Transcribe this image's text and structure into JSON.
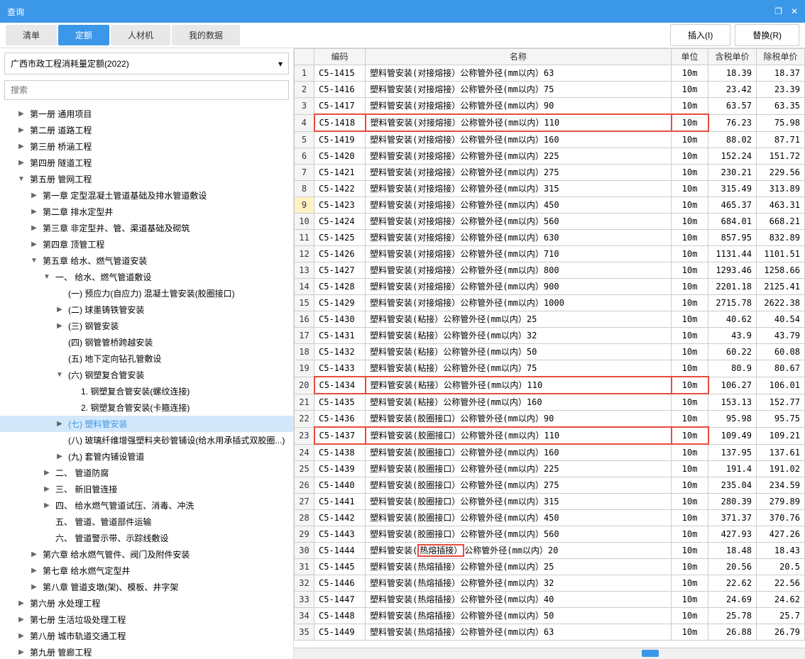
{
  "title": "查询",
  "tabs": [
    "清单",
    "定额",
    "人材机",
    "我的数据"
  ],
  "active_tab": 1,
  "btn_insert": "插入(I)",
  "btn_replace": "替换(R)",
  "dropdown": "广西市政工程消耗量定额(2022)",
  "search_placeholder": "搜索",
  "tree": [
    {
      "d": 1,
      "t": "▶",
      "l": "第一册 通用项目"
    },
    {
      "d": 1,
      "t": "▶",
      "l": "第二册 道路工程"
    },
    {
      "d": 1,
      "t": "▶",
      "l": "第三册 桥涵工程"
    },
    {
      "d": 1,
      "t": "▶",
      "l": "第四册 隧道工程"
    },
    {
      "d": 1,
      "t": "▼",
      "l": "第五册 管网工程"
    },
    {
      "d": 2,
      "t": "▶",
      "l": "第一章 定型混凝土管道基础及排水管道敷设"
    },
    {
      "d": 2,
      "t": "▶",
      "l": "第二章 排水定型井"
    },
    {
      "d": 2,
      "t": "▶",
      "l": "第三章 非定型井、管、渠道基础及砌筑"
    },
    {
      "d": 2,
      "t": "▶",
      "l": "第四章 顶管工程"
    },
    {
      "d": 2,
      "t": "▼",
      "l": "第五章 给水、燃气管道安装"
    },
    {
      "d": 3,
      "t": "▼",
      "l": "一、 给水、燃气管道敷设"
    },
    {
      "d": 4,
      "t": "",
      "l": "(一) 预应力(自应力) 混凝土管安装(胶圈接口)"
    },
    {
      "d": 4,
      "t": "▶",
      "l": "(二) 球墨铸铁管安装"
    },
    {
      "d": 4,
      "t": "▶",
      "l": "(三) 钢管安装"
    },
    {
      "d": 4,
      "t": "",
      "l": "(四) 钢管管桥跨越安装"
    },
    {
      "d": 4,
      "t": "",
      "l": "(五) 地下定向钻孔管敷设"
    },
    {
      "d": 4,
      "t": "▼",
      "l": "(六) 钢塑复合管安装"
    },
    {
      "d": 5,
      "t": "",
      "l": "1. 钢塑复合管安装(螺纹连接)"
    },
    {
      "d": 5,
      "t": "",
      "l": "2. 钢塑复合管安装(卡箍连接)"
    },
    {
      "d": 4,
      "t": "▶",
      "l": "(七) 塑料管安装",
      "sel": true
    },
    {
      "d": 4,
      "t": "",
      "l": "(八) 玻璃纤维增强塑料夹砂管铺设(给水用承插式双胶圈...)"
    },
    {
      "d": 4,
      "t": "▶",
      "l": "(九) 套管内铺设管道"
    },
    {
      "d": 3,
      "t": "▶",
      "l": "二、 管道防腐"
    },
    {
      "d": 3,
      "t": "▶",
      "l": "三、 新旧管连接"
    },
    {
      "d": 3,
      "t": "▶",
      "l": "四、 给水燃气管道试压、消毒、冲洗"
    },
    {
      "d": 3,
      "t": "",
      "l": "五、 管道、管道部件运输"
    },
    {
      "d": 3,
      "t": "",
      "l": "六、 管道警示带、示踪线敷设"
    },
    {
      "d": 2,
      "t": "▶",
      "l": "第六章 给水燃气管件、阀门及附件安装"
    },
    {
      "d": 2,
      "t": "▶",
      "l": "第七章 给水燃气定型井"
    },
    {
      "d": 2,
      "t": "▶",
      "l": "第八章 管道支墩(架)、模板、井字架"
    },
    {
      "d": 1,
      "t": "▶",
      "l": "第六册 水处理工程"
    },
    {
      "d": 1,
      "t": "▶",
      "l": "第七册 生活垃圾处理工程"
    },
    {
      "d": 1,
      "t": "▶",
      "l": "第八册 城市轨道交通工程"
    },
    {
      "d": 1,
      "t": "▶",
      "l": "第九册 管廊工程"
    }
  ],
  "cols": [
    "编码",
    "名称",
    "单位",
    "含税单价",
    "除税单价"
  ],
  "rows": [
    {
      "n": 1,
      "c": "C5-1415",
      "name": "塑料管安装(对接熔接）公称管外径(mm以内）63",
      "u": "10m",
      "p1": "18.39",
      "p2": "18.37"
    },
    {
      "n": 2,
      "c": "C5-1416",
      "name": "塑料管安装(对接熔接）公称管外径(mm以内）75",
      "u": "10m",
      "p1": "23.42",
      "p2": "23.39"
    },
    {
      "n": 3,
      "c": "C5-1417",
      "name": "塑料管安装(对接熔接）公称管外径(mm以内）90",
      "u": "10m",
      "p1": "63.57",
      "p2": "63.35"
    },
    {
      "n": 4,
      "c": "C5-1418",
      "name": "塑料管安装(对接熔接）公称管外径(mm以内）110",
      "u": "10m",
      "p1": "76.23",
      "p2": "75.98",
      "hl": true
    },
    {
      "n": 5,
      "c": "C5-1419",
      "name": "塑料管安装(对接熔接）公称管外径(mm以内）160",
      "u": "10m",
      "p1": "88.02",
      "p2": "87.71"
    },
    {
      "n": 6,
      "c": "C5-1420",
      "name": "塑料管安装(对接熔接）公称管外径(mm以内）225",
      "u": "10m",
      "p1": "152.24",
      "p2": "151.72"
    },
    {
      "n": 7,
      "c": "C5-1421",
      "name": "塑料管安装(对接熔接）公称管外径(mm以内）275",
      "u": "10m",
      "p1": "230.21",
      "p2": "229.56"
    },
    {
      "n": 8,
      "c": "C5-1422",
      "name": "塑料管安装(对接熔接）公称管外径(mm以内）315",
      "u": "10m",
      "p1": "315.49",
      "p2": "313.89"
    },
    {
      "n": 9,
      "c": "C5-1423",
      "name": "塑料管安装(对接熔接）公称管外径(mm以内）450",
      "u": "10m",
      "p1": "465.37",
      "p2": "463.31",
      "sel": true
    },
    {
      "n": 10,
      "c": "C5-1424",
      "name": "塑料管安装(对接熔接）公称管外径(mm以内）560",
      "u": "10m",
      "p1": "684.01",
      "p2": "668.21"
    },
    {
      "n": 11,
      "c": "C5-1425",
      "name": "塑料管安装(对接熔接）公称管外径(mm以内）630",
      "u": "10m",
      "p1": "857.95",
      "p2": "832.89"
    },
    {
      "n": 12,
      "c": "C5-1426",
      "name": "塑料管安装(对接熔接）公称管外径(mm以内）710",
      "u": "10m",
      "p1": "1131.44",
      "p2": "1101.51"
    },
    {
      "n": 13,
      "c": "C5-1427",
      "name": "塑料管安装(对接熔接）公称管外径(mm以内）800",
      "u": "10m",
      "p1": "1293.46",
      "p2": "1258.66"
    },
    {
      "n": 14,
      "c": "C5-1428",
      "name": "塑料管安装(对接熔接）公称管外径(mm以内）900",
      "u": "10m",
      "p1": "2201.18",
      "p2": "2125.41"
    },
    {
      "n": 15,
      "c": "C5-1429",
      "name": "塑料管安装(对接熔接）公称管外径(mm以内）1000",
      "u": "10m",
      "p1": "2715.78",
      "p2": "2622.38"
    },
    {
      "n": 16,
      "c": "C5-1430",
      "name": "塑料管安装(粘接）公称管外径(mm以内）25",
      "u": "10m",
      "p1": "40.62",
      "p2": "40.54"
    },
    {
      "n": 17,
      "c": "C5-1431",
      "name": "塑料管安装(粘接）公称管外径(mm以内）32",
      "u": "10m",
      "p1": "43.9",
      "p2": "43.79"
    },
    {
      "n": 18,
      "c": "C5-1432",
      "name": "塑料管安装(粘接）公称管外径(mm以内）50",
      "u": "10m",
      "p1": "60.22",
      "p2": "60.08"
    },
    {
      "n": 19,
      "c": "C5-1433",
      "name": "塑料管安装(粘接）公称管外径(mm以内）75",
      "u": "10m",
      "p1": "80.9",
      "p2": "80.67"
    },
    {
      "n": 20,
      "c": "C5-1434",
      "name": "塑料管安装(粘接）公称管外径(mm以内）110",
      "u": "10m",
      "p1": "106.27",
      "p2": "106.01",
      "hl": true
    },
    {
      "n": 21,
      "c": "C5-1435",
      "name": "塑料管安装(粘接）公称管外径(mm以内）160",
      "u": "10m",
      "p1": "153.13",
      "p2": "152.77"
    },
    {
      "n": 22,
      "c": "C5-1436",
      "name": "塑料管安装(胶圈接口）公称管外径(mm以内）90",
      "u": "10m",
      "p1": "95.98",
      "p2": "95.75"
    },
    {
      "n": 23,
      "c": "C5-1437",
      "name": "塑料管安装(胶圈接口）公称管外径(mm以内）110",
      "u": "10m",
      "p1": "109.49",
      "p2": "109.21",
      "hl": true
    },
    {
      "n": 24,
      "c": "C5-1438",
      "name": "塑料管安装(胶圈接口）公称管外径(mm以内）160",
      "u": "10m",
      "p1": "137.95",
      "p2": "137.61"
    },
    {
      "n": 25,
      "c": "C5-1439",
      "name": "塑料管安装(胶圈接口）公称管外径(mm以内）225",
      "u": "10m",
      "p1": "191.4",
      "p2": "191.02"
    },
    {
      "n": 26,
      "c": "C5-1440",
      "name": "塑料管安装(胶圈接口）公称管外径(mm以内）275",
      "u": "10m",
      "p1": "235.04",
      "p2": "234.59"
    },
    {
      "n": 27,
      "c": "C5-1441",
      "name": "塑料管安装(胶圈接口）公称管外径(mm以内）315",
      "u": "10m",
      "p1": "280.39",
      "p2": "279.89"
    },
    {
      "n": 28,
      "c": "C5-1442",
      "name": "塑料管安装(胶圈接口）公称管外径(mm以内）450",
      "u": "10m",
      "p1": "371.37",
      "p2": "370.76"
    },
    {
      "n": 29,
      "c": "C5-1443",
      "name": "塑料管安装(胶圈接口）公称管外径(mm以内）560",
      "u": "10m",
      "p1": "427.93",
      "p2": "427.26"
    },
    {
      "n": 30,
      "c": "C5-1444",
      "name": "塑料管安装(热熔插接）公称管外径(mm以内）20",
      "u": "10m",
      "p1": "18.48",
      "p2": "18.43",
      "hl2": true
    },
    {
      "n": 31,
      "c": "C5-1445",
      "name": "塑料管安装(热熔插接）公称管外径(mm以内）25",
      "u": "10m",
      "p1": "20.56",
      "p2": "20.5"
    },
    {
      "n": 32,
      "c": "C5-1446",
      "name": "塑料管安装(热熔插接）公称管外径(mm以内）32",
      "u": "10m",
      "p1": "22.62",
      "p2": "22.56"
    },
    {
      "n": 33,
      "c": "C5-1447",
      "name": "塑料管安装(热熔插接）公称管外径(mm以内）40",
      "u": "10m",
      "p1": "24.69",
      "p2": "24.62"
    },
    {
      "n": 34,
      "c": "C5-1448",
      "name": "塑料管安装(热熔插接）公称管外径(mm以内）50",
      "u": "10m",
      "p1": "25.78",
      "p2": "25.7"
    },
    {
      "n": 35,
      "c": "C5-1449",
      "name": "塑料管安装(热熔插接）公称管外径(mm以内）63",
      "u": "10m",
      "p1": "26.88",
      "p2": "26.79"
    }
  ]
}
